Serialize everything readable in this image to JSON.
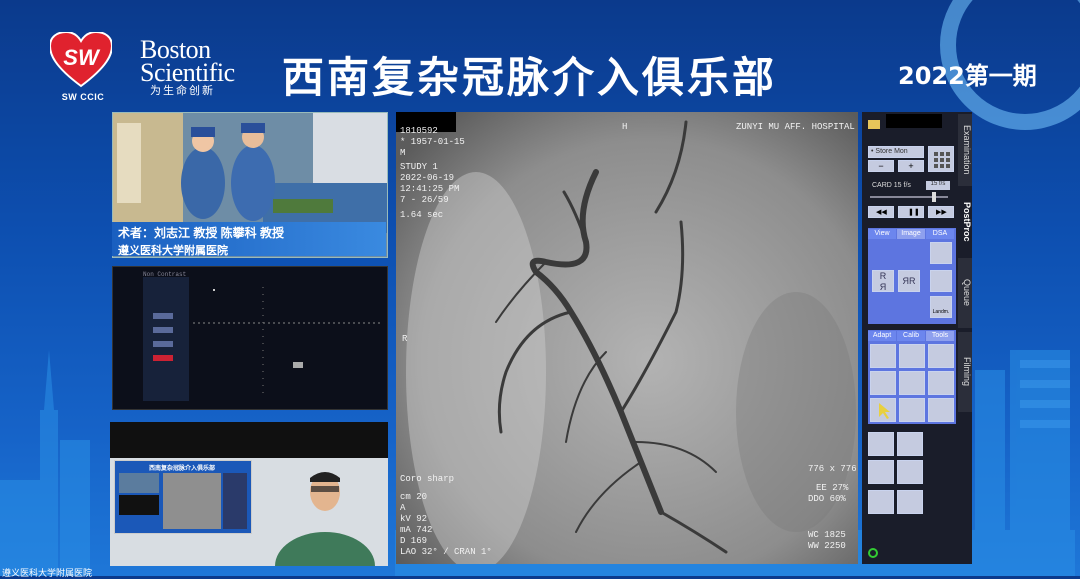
{
  "header": {
    "logo_mark": "SW",
    "logo_sub": "SW CCIC",
    "brand_name": "Boston Scientific",
    "brand_tagline": "为生命创新",
    "title": "西南复杂冠脉介入俱乐部",
    "issue": "2022第一期"
  },
  "video": {
    "surgeons_line": "术者：刘志江 教授 陈攀科 教授",
    "hospital_line": "遵义医科大学附属医院"
  },
  "monitor": {
    "topline": "Non Contrast"
  },
  "angio": {
    "patient_id": "1810592",
    "dob": "* 1957-01-15",
    "sex": "M",
    "study": "STUDY 1",
    "date": "2022-06-19",
    "time": "12:41:25 PM",
    "frame": "7 - 26/59",
    "duration": "1.64 sec",
    "orient_top": "H",
    "orient_left": "R",
    "hospital": "ZUNYI MU AFF. HOSPITAL",
    "filter": "Coro sharp",
    "params": [
      "cm 20",
      "A",
      "kV 92",
      "mA 742",
      "D 169",
      "LAO 32° / CRAN 1°"
    ],
    "matrix": "776 x 776",
    "ee": "EE 27%",
    "ddo": "DDO 60%",
    "wc": "WC 1825",
    "ww": "WW 2250"
  },
  "tools": {
    "store_mon": "• Store Mon",
    "minus": "−",
    "plus": "+",
    "card_label": "CARD 15 f/s",
    "card_value": "15 f/s",
    "view_tabs": [
      "View",
      "Image",
      "DSA"
    ],
    "tool_tabs": [
      "Adapt",
      "Calib",
      "Tools"
    ],
    "side_tabs": [
      "Examination",
      "PostProc",
      "Queue",
      "Filming"
    ],
    "landmark": "Landm."
  },
  "cam": {
    "mini_title": "西南复杂冠脉介入俱乐部"
  },
  "footer": {
    "hospital": "遵义医科大学附属医院"
  }
}
